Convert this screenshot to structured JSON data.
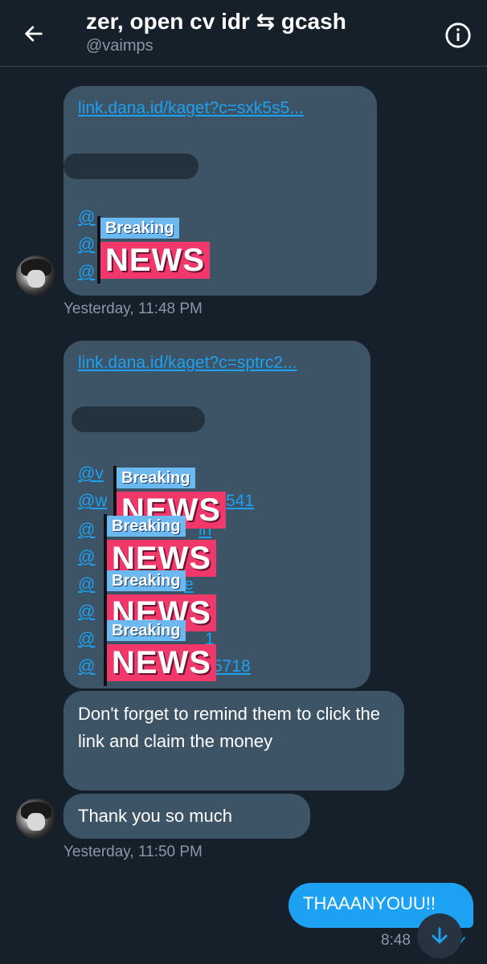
{
  "header": {
    "title": "zer, open cv idr ⇆ gcash",
    "handle": "@vaimps",
    "back_icon": "arrow-left-icon",
    "info_icon": "info-icon"
  },
  "messages": {
    "m1": {
      "link": "link.dana.id/kaget?c=sxk5s5...",
      "mentions": [
        "@",
        "@",
        "@"
      ],
      "sticker_breaking": "Breaking",
      "sticker_news": "NEWS"
    },
    "ts1": "Yesterday, 11:48 PM",
    "m2": {
      "link": "link.dana.id/kaget?c=sptrc2...",
      "mentions": [
        "@v",
        "@w",
        "@",
        "@",
        "@",
        "@",
        "@",
        "@"
      ],
      "mention_tails": [
        "541",
        "in",
        "e",
        "1",
        "5718"
      ],
      "stickers": [
        {
          "breaking": "Breaking",
          "news": "NEWS"
        },
        {
          "breaking": "Breaking",
          "news": "NEWS"
        },
        {
          "breaking": "Breaking",
          "news": "NEWS"
        },
        {
          "breaking": "Breaking",
          "news": "NEWS"
        }
      ]
    },
    "m3": "Don't forget to remind them to click the link and claim the money",
    "m4": "Thank you so much",
    "ts2": "Yesterday, 11:50 PM",
    "out": {
      "text": "THAAANYOUU!!",
      "time": "8:48",
      "status": "✓"
    }
  },
  "colors": {
    "background": "#15202b",
    "incoming_bubble": "#3d5466",
    "outgoing_bubble": "#1da1f2",
    "link": "#1da1f2",
    "muted_text": "#8899a6"
  },
  "scroll_icon": "arrow-down-icon"
}
